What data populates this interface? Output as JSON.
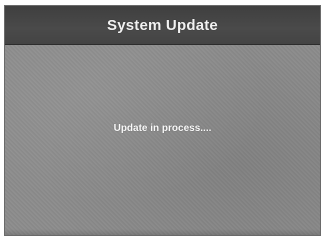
{
  "dialog": {
    "title": "System Update",
    "status": "Update in process...."
  },
  "colors": {
    "title_bar": "#444444",
    "background": "#8c8c8c",
    "text": "#f2f2f2"
  }
}
